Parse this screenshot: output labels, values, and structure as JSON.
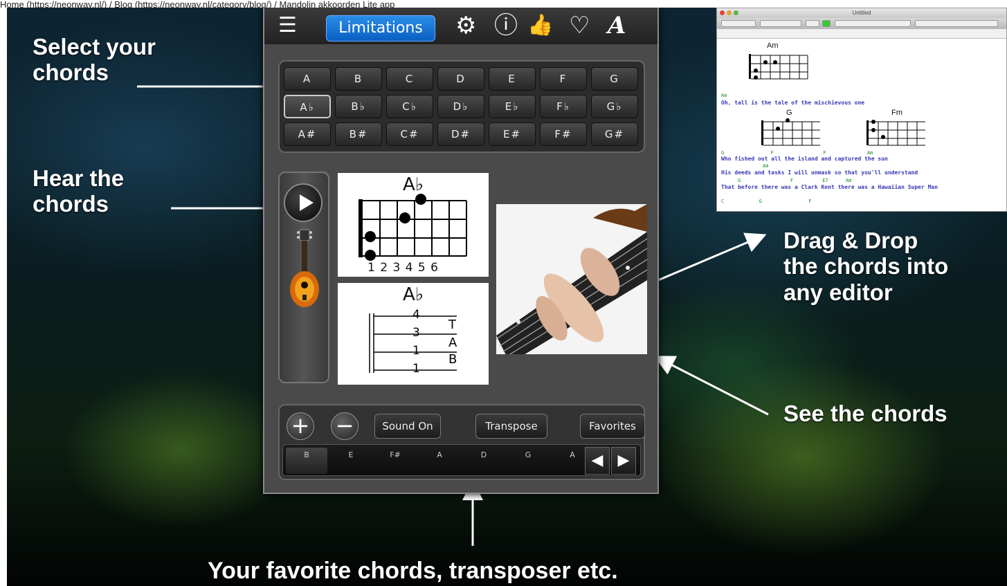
{
  "breadcrumb": "Home (https://neonway.nl/) / Blog (https://neonway.nl/category/blog/) / Mandolin akkoorden Lite app",
  "callouts": {
    "select": "Select your\nchords",
    "hear": "Hear the\nchords",
    "drag": "Drag & Drop\nthe chords into\nany editor",
    "see": "See the chords",
    "favorites": "Your favorite chords, transposer  etc."
  },
  "toolbar": {
    "limitations_label": "Limitations",
    "icons": [
      "menu-icon",
      "gear-icon",
      "info-icon",
      "thumbs-up-icon",
      "heart-icon",
      "font-icon"
    ],
    "menu_glyph": "☰",
    "gear_glyph": "⚙",
    "info_glyph": "ⓘ",
    "thumb_glyph": "👍",
    "heart_glyph": "♡",
    "font_glyph": "A"
  },
  "chords": {
    "natural": [
      "A",
      "B",
      "C",
      "D",
      "E",
      "F",
      "G"
    ],
    "flat": [
      "A♭",
      "B♭",
      "C♭",
      "D♭",
      "E♭",
      "F♭",
      "G♭"
    ],
    "sharp": [
      "A#",
      "B#",
      "C#",
      "D#",
      "E#",
      "F#",
      "G#"
    ],
    "selected": "A♭"
  },
  "diagram": {
    "title": "A♭",
    "fret_numbers": "1 2 3 4 5 6",
    "tab_title": "A♭",
    "tab_numbers": [
      "4",
      "3",
      "1",
      "1"
    ],
    "tab_letters": [
      "T",
      "A",
      "B"
    ]
  },
  "bottom": {
    "plus": "+",
    "minus": "−",
    "sound_label": "Sound On",
    "transpose_label": "Transpose",
    "favorites_label": "Favorites",
    "fav_chords": [
      "B",
      "E",
      "F#",
      "A",
      "D",
      "G",
      "A"
    ],
    "prev": "◀",
    "next": "▶"
  },
  "editor": {
    "window_title": "Untitled",
    "chord_am": "Am",
    "chord_g": "G",
    "chord_fm": "Fm",
    "lyrics": [
      "Oh, tall is the tale of the mischievous one",
      "Who fished out all the island and captured the sun",
      "His deeds and tasks I will unmask so that you'll understand",
      "That before there was a Clark Kent there was a Hawaiian Super Man"
    ],
    "green_row1": "Am",
    "green_row2": "G                F                 F              Am",
    "green_row3": "Am",
    "green_row4": "G                 F          E7      Am",
    "green_row5": "C            G                F"
  },
  "colors": {
    "accent": "#0b5fc2",
    "lyric": "#3838b8",
    "chord_green": "#1a8a1a"
  }
}
